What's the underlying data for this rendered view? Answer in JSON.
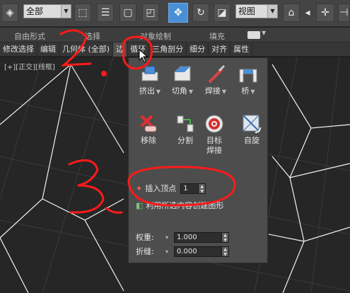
{
  "toolbar": {
    "selection_filter": "全部",
    "view_coord": "视图"
  },
  "ribbon": {
    "groups": [
      "自由形式",
      "选择",
      "对象绘制",
      "填充"
    ]
  },
  "tabs": [
    {
      "label": "修改选择"
    },
    {
      "label": "编辑"
    },
    {
      "label": "几何体 (全部)"
    },
    {
      "label": "边"
    },
    {
      "label": "循环"
    },
    {
      "label": "三角剖分"
    },
    {
      "label": "细分"
    },
    {
      "label": "对齐"
    },
    {
      "label": "属性"
    }
  ],
  "viewport": {
    "label": "[+][正交][线框]"
  },
  "panel": {
    "tools": [
      {
        "label": "挤出",
        "icon": "extrude-icon"
      },
      {
        "label": "切角",
        "icon": "chamfer-icon"
      },
      {
        "label": "焊接",
        "icon": "weld-icon"
      },
      {
        "label": "桥",
        "icon": "bridge-icon"
      },
      {
        "label": "移除",
        "icon": "remove-icon"
      },
      {
        "label": "分割",
        "icon": "split-icon"
      },
      {
        "label": "目标\n焊接",
        "label_line1": "目标",
        "label_line2": "焊接",
        "icon": "target-weld-icon"
      },
      {
        "label": "自旋",
        "icon": "spin-icon"
      }
    ],
    "insert_vertex": {
      "label": "插入顶点",
      "value": "1"
    },
    "create_shape": {
      "label": "利用所选内容创建图形"
    },
    "weight": {
      "label": "权重:",
      "value": "1.000"
    },
    "crease": {
      "label": "折缝:",
      "value": "0.000"
    }
  },
  "annotations": [
    "2.",
    "3."
  ],
  "colors": {
    "accent": "#4a8fd6",
    "annotation": "#ff1a1a",
    "panel_bg": "#4d4d4d"
  }
}
